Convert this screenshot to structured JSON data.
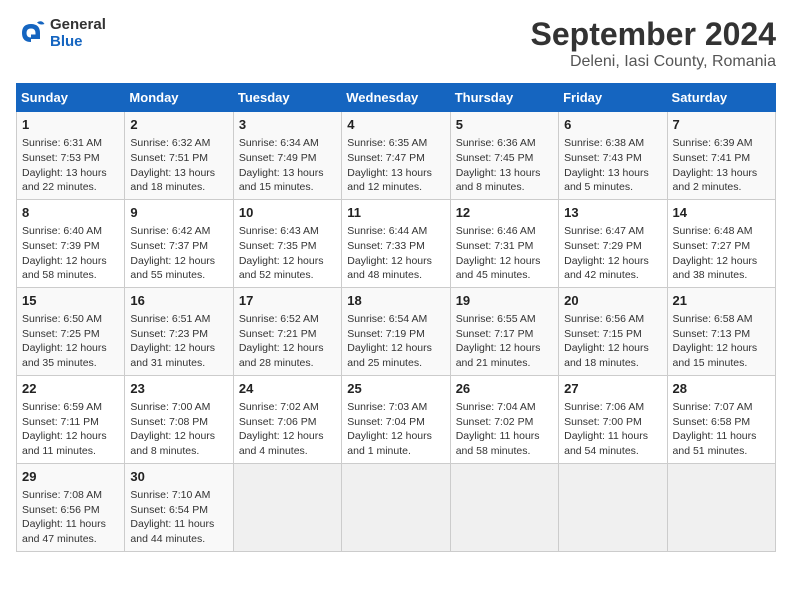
{
  "header": {
    "logo_line1": "General",
    "logo_line2": "Blue",
    "month": "September 2024",
    "location": "Deleni, Iasi County, Romania"
  },
  "weekdays": [
    "Sunday",
    "Monday",
    "Tuesday",
    "Wednesday",
    "Thursday",
    "Friday",
    "Saturday"
  ],
  "weeks": [
    [
      {
        "day": "1",
        "info": "Sunrise: 6:31 AM\nSunset: 7:53 PM\nDaylight: 13 hours\nand 22 minutes."
      },
      {
        "day": "2",
        "info": "Sunrise: 6:32 AM\nSunset: 7:51 PM\nDaylight: 13 hours\nand 18 minutes."
      },
      {
        "day": "3",
        "info": "Sunrise: 6:34 AM\nSunset: 7:49 PM\nDaylight: 13 hours\nand 15 minutes."
      },
      {
        "day": "4",
        "info": "Sunrise: 6:35 AM\nSunset: 7:47 PM\nDaylight: 13 hours\nand 12 minutes."
      },
      {
        "day": "5",
        "info": "Sunrise: 6:36 AM\nSunset: 7:45 PM\nDaylight: 13 hours\nand 8 minutes."
      },
      {
        "day": "6",
        "info": "Sunrise: 6:38 AM\nSunset: 7:43 PM\nDaylight: 13 hours\nand 5 minutes."
      },
      {
        "day": "7",
        "info": "Sunrise: 6:39 AM\nSunset: 7:41 PM\nDaylight: 13 hours\nand 2 minutes."
      }
    ],
    [
      {
        "day": "8",
        "info": "Sunrise: 6:40 AM\nSunset: 7:39 PM\nDaylight: 12 hours\nand 58 minutes."
      },
      {
        "day": "9",
        "info": "Sunrise: 6:42 AM\nSunset: 7:37 PM\nDaylight: 12 hours\nand 55 minutes."
      },
      {
        "day": "10",
        "info": "Sunrise: 6:43 AM\nSunset: 7:35 PM\nDaylight: 12 hours\nand 52 minutes."
      },
      {
        "day": "11",
        "info": "Sunrise: 6:44 AM\nSunset: 7:33 PM\nDaylight: 12 hours\nand 48 minutes."
      },
      {
        "day": "12",
        "info": "Sunrise: 6:46 AM\nSunset: 7:31 PM\nDaylight: 12 hours\nand 45 minutes."
      },
      {
        "day": "13",
        "info": "Sunrise: 6:47 AM\nSunset: 7:29 PM\nDaylight: 12 hours\nand 42 minutes."
      },
      {
        "day": "14",
        "info": "Sunrise: 6:48 AM\nSunset: 7:27 PM\nDaylight: 12 hours\nand 38 minutes."
      }
    ],
    [
      {
        "day": "15",
        "info": "Sunrise: 6:50 AM\nSunset: 7:25 PM\nDaylight: 12 hours\nand 35 minutes."
      },
      {
        "day": "16",
        "info": "Sunrise: 6:51 AM\nSunset: 7:23 PM\nDaylight: 12 hours\nand 31 minutes."
      },
      {
        "day": "17",
        "info": "Sunrise: 6:52 AM\nSunset: 7:21 PM\nDaylight: 12 hours\nand 28 minutes."
      },
      {
        "day": "18",
        "info": "Sunrise: 6:54 AM\nSunset: 7:19 PM\nDaylight: 12 hours\nand 25 minutes."
      },
      {
        "day": "19",
        "info": "Sunrise: 6:55 AM\nSunset: 7:17 PM\nDaylight: 12 hours\nand 21 minutes."
      },
      {
        "day": "20",
        "info": "Sunrise: 6:56 AM\nSunset: 7:15 PM\nDaylight: 12 hours\nand 18 minutes."
      },
      {
        "day": "21",
        "info": "Sunrise: 6:58 AM\nSunset: 7:13 PM\nDaylight: 12 hours\nand 15 minutes."
      }
    ],
    [
      {
        "day": "22",
        "info": "Sunrise: 6:59 AM\nSunset: 7:11 PM\nDaylight: 12 hours\nand 11 minutes."
      },
      {
        "day": "23",
        "info": "Sunrise: 7:00 AM\nSunset: 7:08 PM\nDaylight: 12 hours\nand 8 minutes."
      },
      {
        "day": "24",
        "info": "Sunrise: 7:02 AM\nSunset: 7:06 PM\nDaylight: 12 hours\nand 4 minutes."
      },
      {
        "day": "25",
        "info": "Sunrise: 7:03 AM\nSunset: 7:04 PM\nDaylight: 12 hours\nand 1 minute."
      },
      {
        "day": "26",
        "info": "Sunrise: 7:04 AM\nSunset: 7:02 PM\nDaylight: 11 hours\nand 58 minutes."
      },
      {
        "day": "27",
        "info": "Sunrise: 7:06 AM\nSunset: 7:00 PM\nDaylight: 11 hours\nand 54 minutes."
      },
      {
        "day": "28",
        "info": "Sunrise: 7:07 AM\nSunset: 6:58 PM\nDaylight: 11 hours\nand 51 minutes."
      }
    ],
    [
      {
        "day": "29",
        "info": "Sunrise: 7:08 AM\nSunset: 6:56 PM\nDaylight: 11 hours\nand 47 minutes."
      },
      {
        "day": "30",
        "info": "Sunrise: 7:10 AM\nSunset: 6:54 PM\nDaylight: 11 hours\nand 44 minutes."
      },
      {
        "day": "",
        "info": ""
      },
      {
        "day": "",
        "info": ""
      },
      {
        "day": "",
        "info": ""
      },
      {
        "day": "",
        "info": ""
      },
      {
        "day": "",
        "info": ""
      }
    ]
  ]
}
